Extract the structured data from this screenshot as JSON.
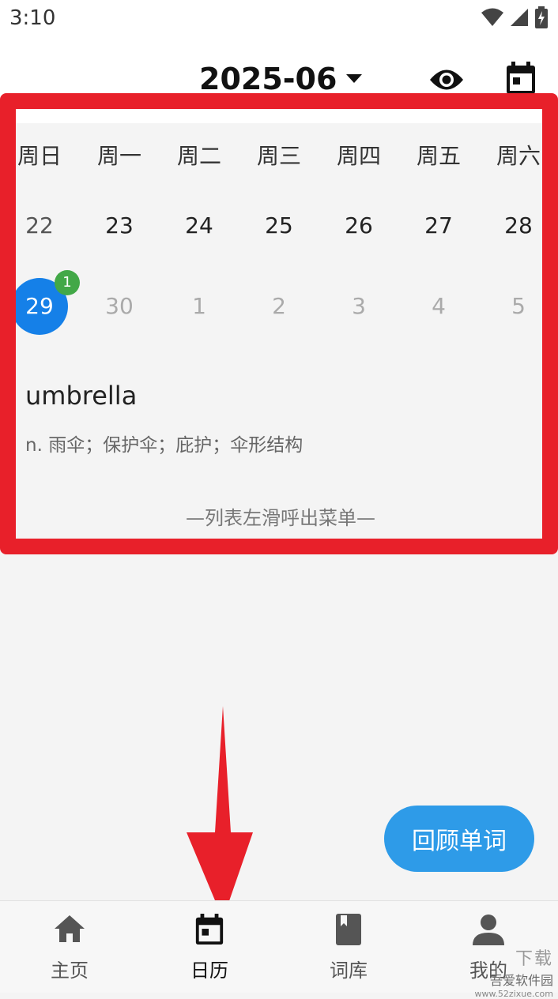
{
  "status_bar": {
    "time": "3:10",
    "icons": [
      "wifi-icon",
      "cell-signal-icon",
      "battery-charging-icon"
    ]
  },
  "header": {
    "month": "2025-06",
    "month_dropdown_icon": "caret-down-icon",
    "actions": [
      "eye-icon",
      "calendar-icon"
    ]
  },
  "calendar": {
    "weekdays": [
      "周日",
      "周一",
      "周二",
      "周三",
      "周四",
      "周五",
      "周六"
    ],
    "rows": [
      [
        {
          "day": "22",
          "state": "current-sunday"
        },
        {
          "day": "23",
          "state": "current"
        },
        {
          "day": "24",
          "state": "current"
        },
        {
          "day": "25",
          "state": "current"
        },
        {
          "day": "26",
          "state": "current"
        },
        {
          "day": "27",
          "state": "current"
        },
        {
          "day": "28",
          "state": "current"
        }
      ],
      [
        {
          "day": "29",
          "state": "today",
          "badge": "1"
        },
        {
          "day": "30",
          "state": "dim"
        },
        {
          "day": "1",
          "state": "dim"
        },
        {
          "day": "2",
          "state": "dim"
        },
        {
          "day": "3",
          "state": "dim"
        },
        {
          "day": "4",
          "state": "dim"
        },
        {
          "day": "5",
          "state": "dim"
        }
      ]
    ],
    "today_color": "#1580e8",
    "badge_color": "#42a847"
  },
  "entry": {
    "word": "umbrella",
    "meaning": "n. 雨伞；保护伞；庇护；伞形结构"
  },
  "hint": "—列表左滑呼出菜单—",
  "review_button": {
    "label": "回顾单词",
    "color": "#2e9be8"
  },
  "bottom_nav": {
    "items": [
      {
        "label": "主页",
        "icon": "home-icon",
        "active": false
      },
      {
        "label": "日历",
        "icon": "calendar-icon",
        "active": true
      },
      {
        "label": "词库",
        "icon": "book-icon",
        "active": false
      },
      {
        "label": "我的",
        "icon": "person-icon",
        "active": false
      }
    ]
  },
  "annotation": {
    "highlight_color": "#e8202a"
  },
  "watermark": {
    "line1": "下载",
    "line2": "吾爱软件园",
    "url": "www.52zixue.com"
  }
}
